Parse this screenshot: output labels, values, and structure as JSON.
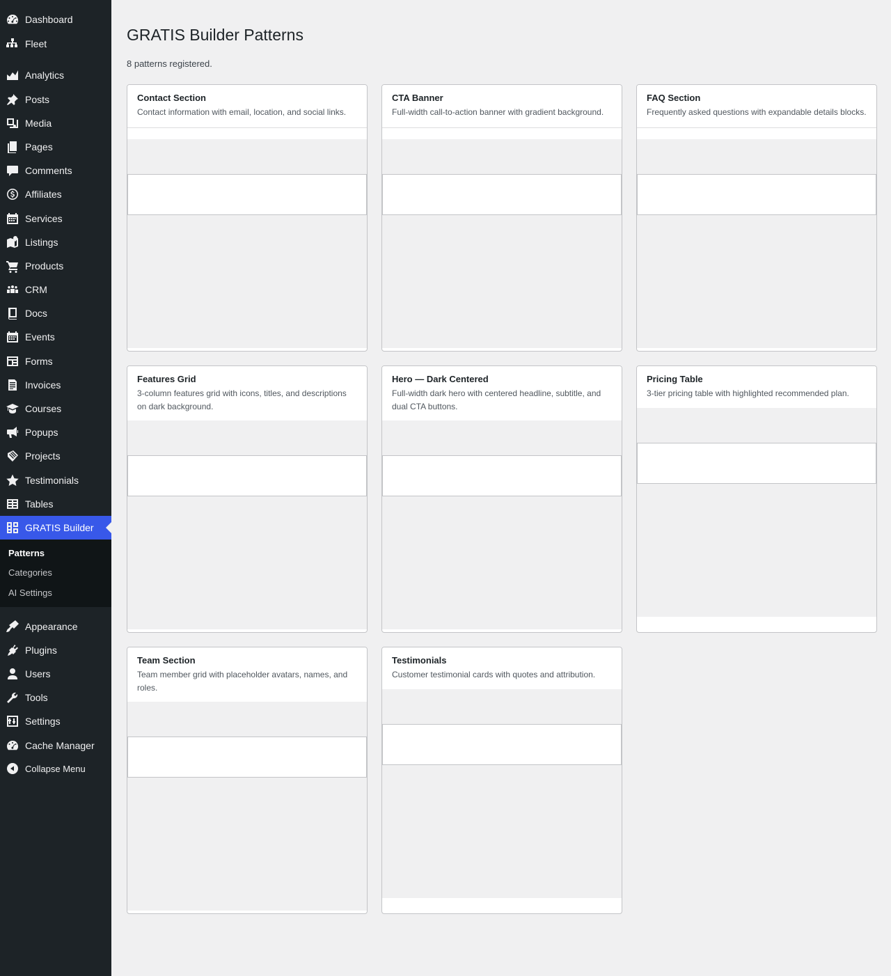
{
  "sidebar": {
    "items": [
      {
        "label": "Dashboard",
        "icon": "dashboard-icon"
      },
      {
        "label": "Fleet",
        "icon": "network-icon"
      },
      {
        "label": "Analytics",
        "icon": "chart-area-icon"
      },
      {
        "label": "Posts",
        "icon": "pin-icon"
      },
      {
        "label": "Media",
        "icon": "media-icon"
      },
      {
        "label": "Pages",
        "icon": "pages-icon"
      },
      {
        "label": "Comments",
        "icon": "comment-icon"
      },
      {
        "label": "Affiliates",
        "icon": "dollar-icon"
      },
      {
        "label": "Services",
        "icon": "calendar-icon"
      },
      {
        "label": "Listings",
        "icon": "map-icon"
      },
      {
        "label": "Products",
        "icon": "cart-icon"
      },
      {
        "label": "CRM",
        "icon": "groups-icon"
      },
      {
        "label": "Docs",
        "icon": "book-icon"
      },
      {
        "label": "Events",
        "icon": "calendar-icon"
      },
      {
        "label": "Forms",
        "icon": "feedback-icon"
      },
      {
        "label": "Invoices",
        "icon": "document-icon"
      },
      {
        "label": "Courses",
        "icon": "education-icon"
      },
      {
        "label": "Popups",
        "icon": "megaphone-icon"
      },
      {
        "label": "Projects",
        "icon": "portfolio-icon"
      },
      {
        "label": "Testimonials",
        "icon": "star-icon"
      },
      {
        "label": "Tables",
        "icon": "table-icon"
      },
      {
        "label": "GRATIS Builder",
        "icon": "layout-icon"
      }
    ],
    "submenu": [
      "Patterns",
      "Categories",
      "AI Settings"
    ],
    "lower_items": [
      {
        "label": "Appearance",
        "icon": "brush-icon"
      },
      {
        "label": "Plugins",
        "icon": "plugin-icon"
      },
      {
        "label": "Users",
        "icon": "user-icon"
      },
      {
        "label": "Tools",
        "icon": "wrench-icon"
      },
      {
        "label": "Settings",
        "icon": "settings-icon"
      },
      {
        "label": "Cache Manager",
        "icon": "gauge-icon"
      }
    ],
    "collapse_label": "Collapse Menu"
  },
  "page": {
    "title": "GRATIS Builder Patterns",
    "count_text": "8 patterns registered."
  },
  "patterns": [
    {
      "title": "Contact Section",
      "description": "Contact information with email, location, and social links."
    },
    {
      "title": "CTA Banner",
      "description": "Full-width call-to-action banner with gradient background."
    },
    {
      "title": "FAQ Section",
      "description": "Frequently asked questions with expandable details blocks."
    },
    {
      "title": "Features Grid",
      "description": "3-column features grid with icons, titles, and descriptions on dark background."
    },
    {
      "title": "Hero — Dark Centered",
      "description": "Full-width dark hero with centered headline, subtitle, and dual CTA buttons."
    },
    {
      "title": "Pricing Table",
      "description": "3-tier pricing table with highlighted recommended plan."
    },
    {
      "title": "Team Section",
      "description": "Team member grid with placeholder avatars, names, and roles."
    },
    {
      "title": "Testimonials",
      "description": "Customer testimonial cards with quotes and attribution."
    }
  ],
  "colors": {
    "sidebar_bg": "#1d2327",
    "accent": "#3858e9",
    "page_bg": "#f0f0f1"
  }
}
